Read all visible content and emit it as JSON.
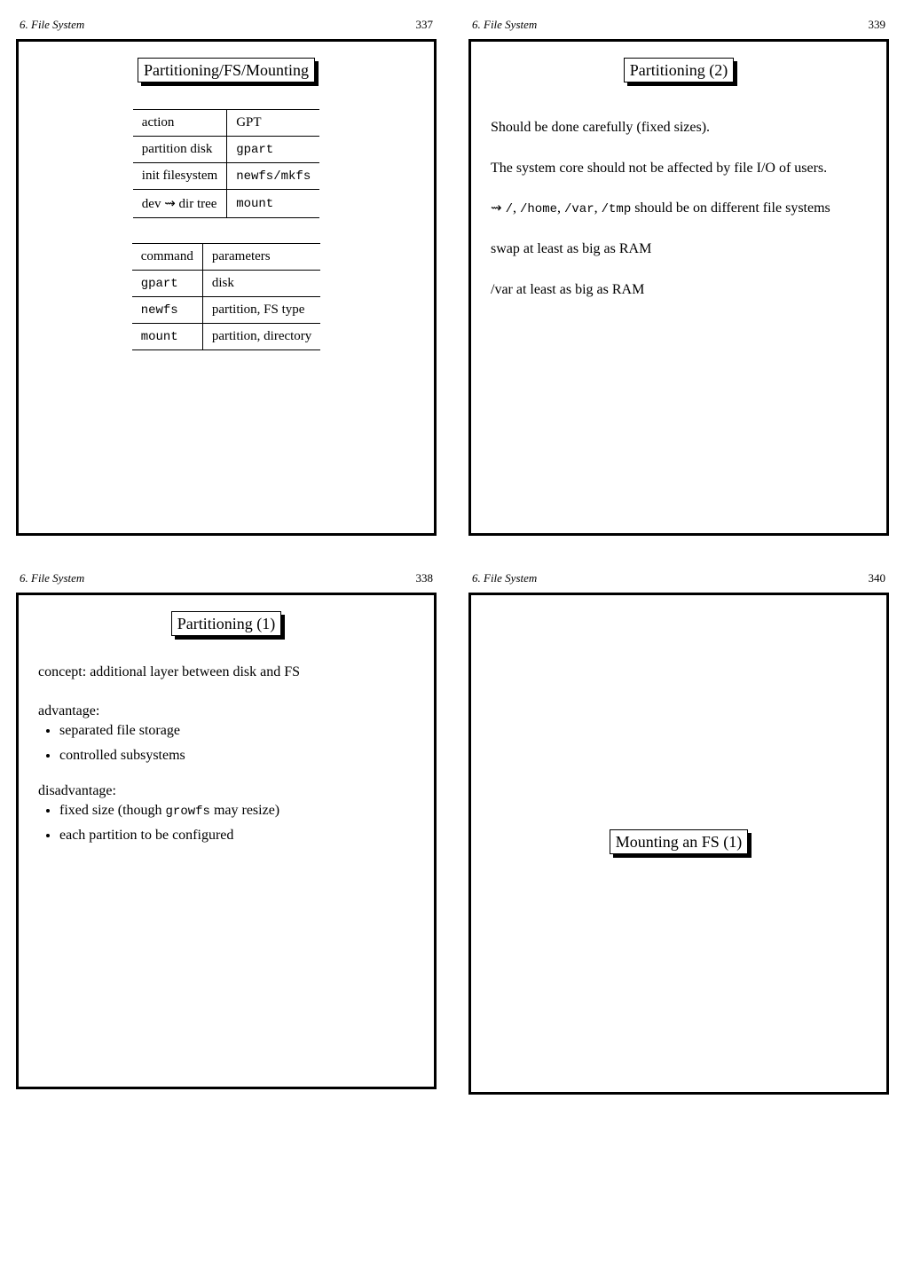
{
  "chapter": "6. File System",
  "slides": {
    "s337": {
      "page": "337",
      "title": "Partitioning/FS/Mounting",
      "table1": {
        "r0c0": "action",
        "r0c1": "GPT",
        "r1c0": "partition disk",
        "r1c1": "gpart",
        "r2c0": "init filesystem",
        "r2c1": "newfs/mkfs",
        "r3c0a": "dev ",
        "r3c0arrow": "⇝",
        "r3c0b": " dir tree",
        "r3c1": "mount"
      },
      "table2": {
        "r0c0": "command",
        "r0c1": "parameters",
        "r1c0": "gpart",
        "r1c1": "disk",
        "r2c0": "newfs",
        "r2c1": "partition, FS type",
        "r3c0": "mount",
        "r3c1": "partition, directory"
      }
    },
    "s338": {
      "page": "338",
      "title": "Partitioning (1)",
      "line1": "concept: additional layer between disk and FS",
      "adv_label": "advantage:",
      "adv1": "separated file storage",
      "adv2": "controlled subsystems",
      "dis_label": "disadvantage:",
      "dis1_a": "fixed size (though ",
      "dis1_code": "growfs",
      "dis1_b": " may resize)",
      "dis2": "each partition to be configured"
    },
    "s339": {
      "page": "339",
      "title": "Partitioning (2)",
      "p1": "Should be done carefully (fixed sizes).",
      "p2": "The system core should not be affected by file I/O of users.",
      "p3_lead": "⇝",
      "p3_code1": "/",
      "p3_sep1": ", ",
      "p3_code2": "/home",
      "p3_sep2": ", ",
      "p3_code3": "/var",
      "p3_sep3": ", ",
      "p3_code4": "/tmp",
      "p3_tail": " should be on different file systems",
      "p4": "swap at least as big as RAM",
      "p5": "/var at least as big as RAM"
    },
    "s340": {
      "page": "340",
      "title": "Mounting an FS (1)"
    }
  }
}
